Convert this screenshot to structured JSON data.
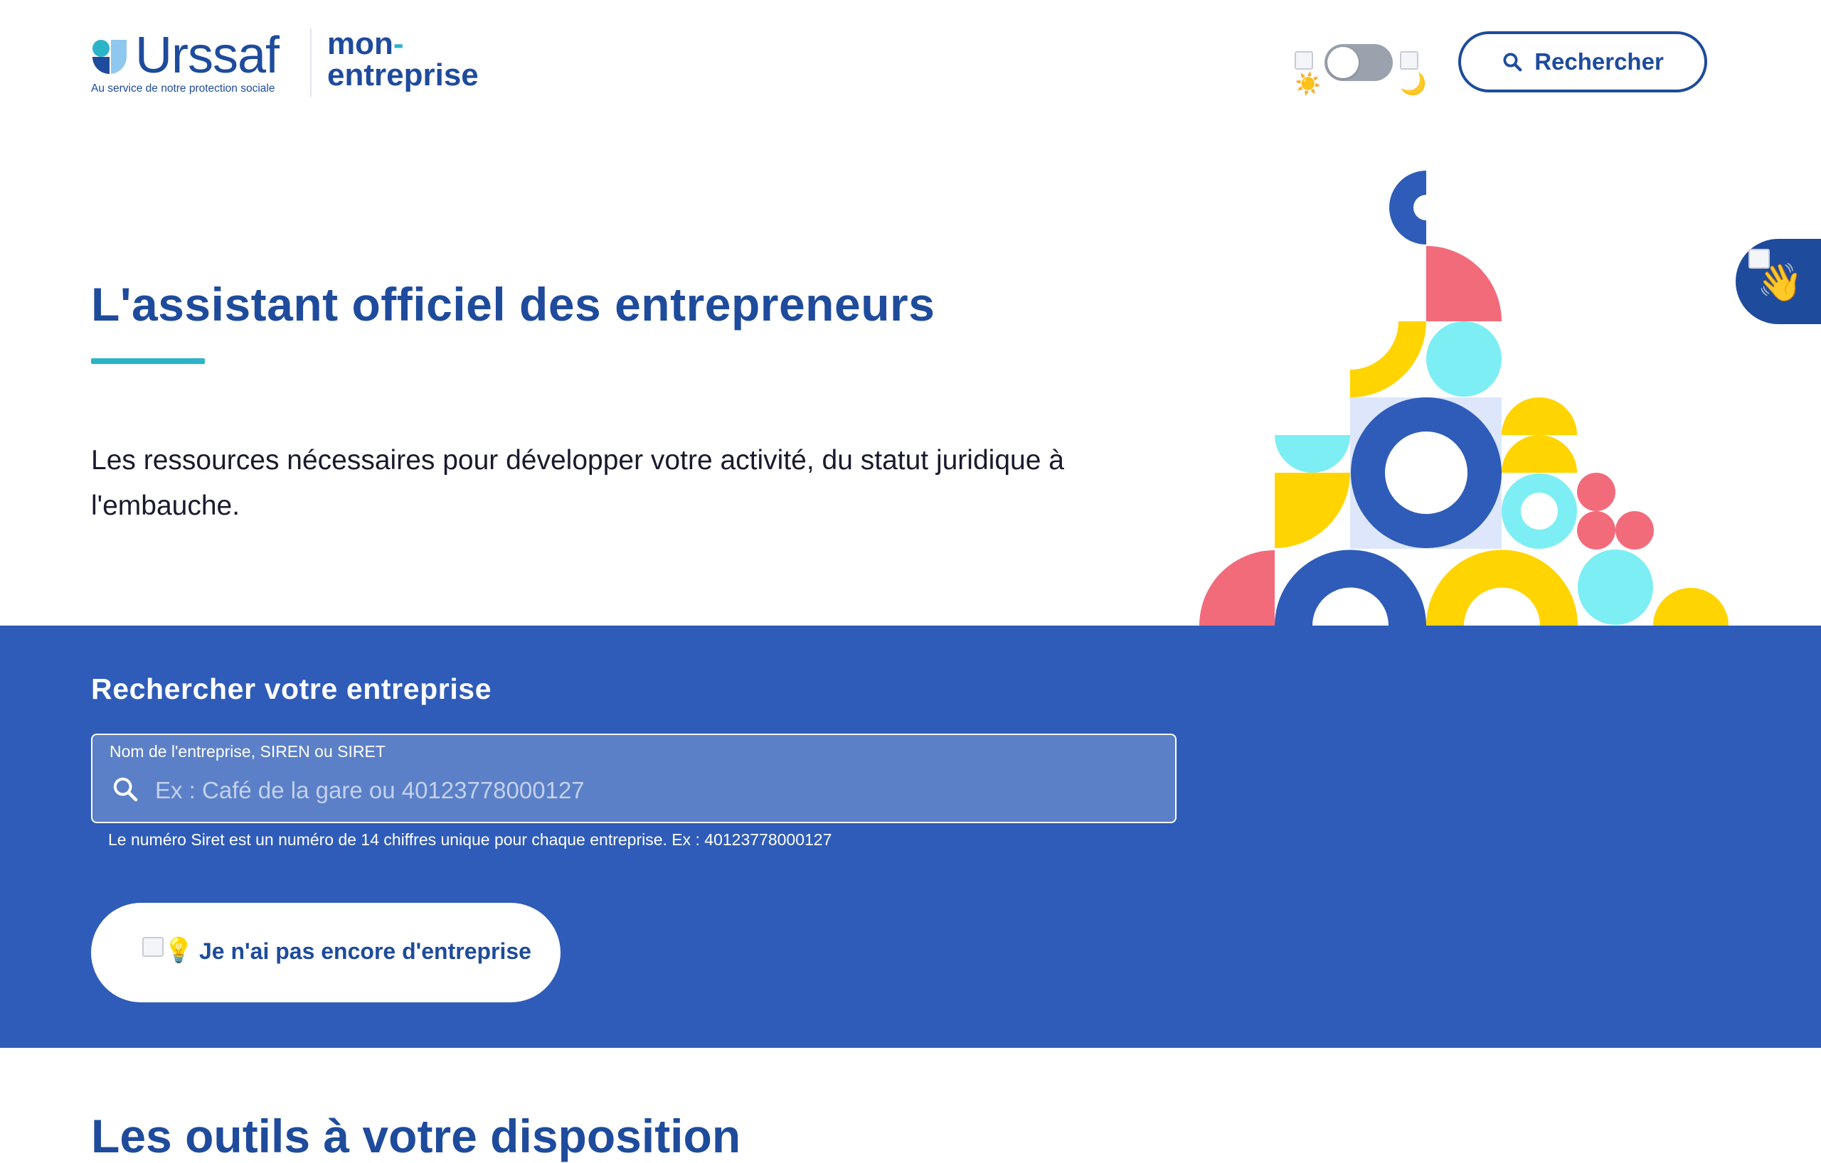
{
  "header": {
    "brand_name": "Urssaf",
    "brand_tagline": "Au service de notre protection sociale",
    "product_line1": "mon",
    "product_dash": "-",
    "product_line2": "entreprise",
    "theme_light_icon": "sun-icon",
    "theme_dark_icon": "moon-icon",
    "search_button_label": "Rechercher"
  },
  "hero": {
    "title": "L'assistant officiel des entrepreneurs",
    "text": "Les ressources nécessaires pour développer votre activité, du statut juridique à l'embauche."
  },
  "search": {
    "title": "Rechercher votre entreprise",
    "field_label": "Nom de l'entreprise, SIREN ou SIRET",
    "placeholder": "Ex : Café de la gare ou 40123778000127",
    "value": "",
    "hint": "Le numéro Siret est un numéro de 14 chiffres unique pour chaque entreprise. Ex : 40123778000127"
  },
  "no_company_button": {
    "emoji": "💡",
    "label": "Je n'ai pas encore d'entreprise"
  },
  "side_tab": {
    "emoji": "👋"
  },
  "tools": {
    "title": "Les outils à votre disposition"
  },
  "colors": {
    "brand_blue": "#1e4b9c",
    "band_blue": "#2f5cb8",
    "accent_cyan": "#2bb4c8",
    "shape_yellow": "#ffd400",
    "shape_pink": "#f26b7b",
    "shape_light_cyan": "#7deef3"
  }
}
